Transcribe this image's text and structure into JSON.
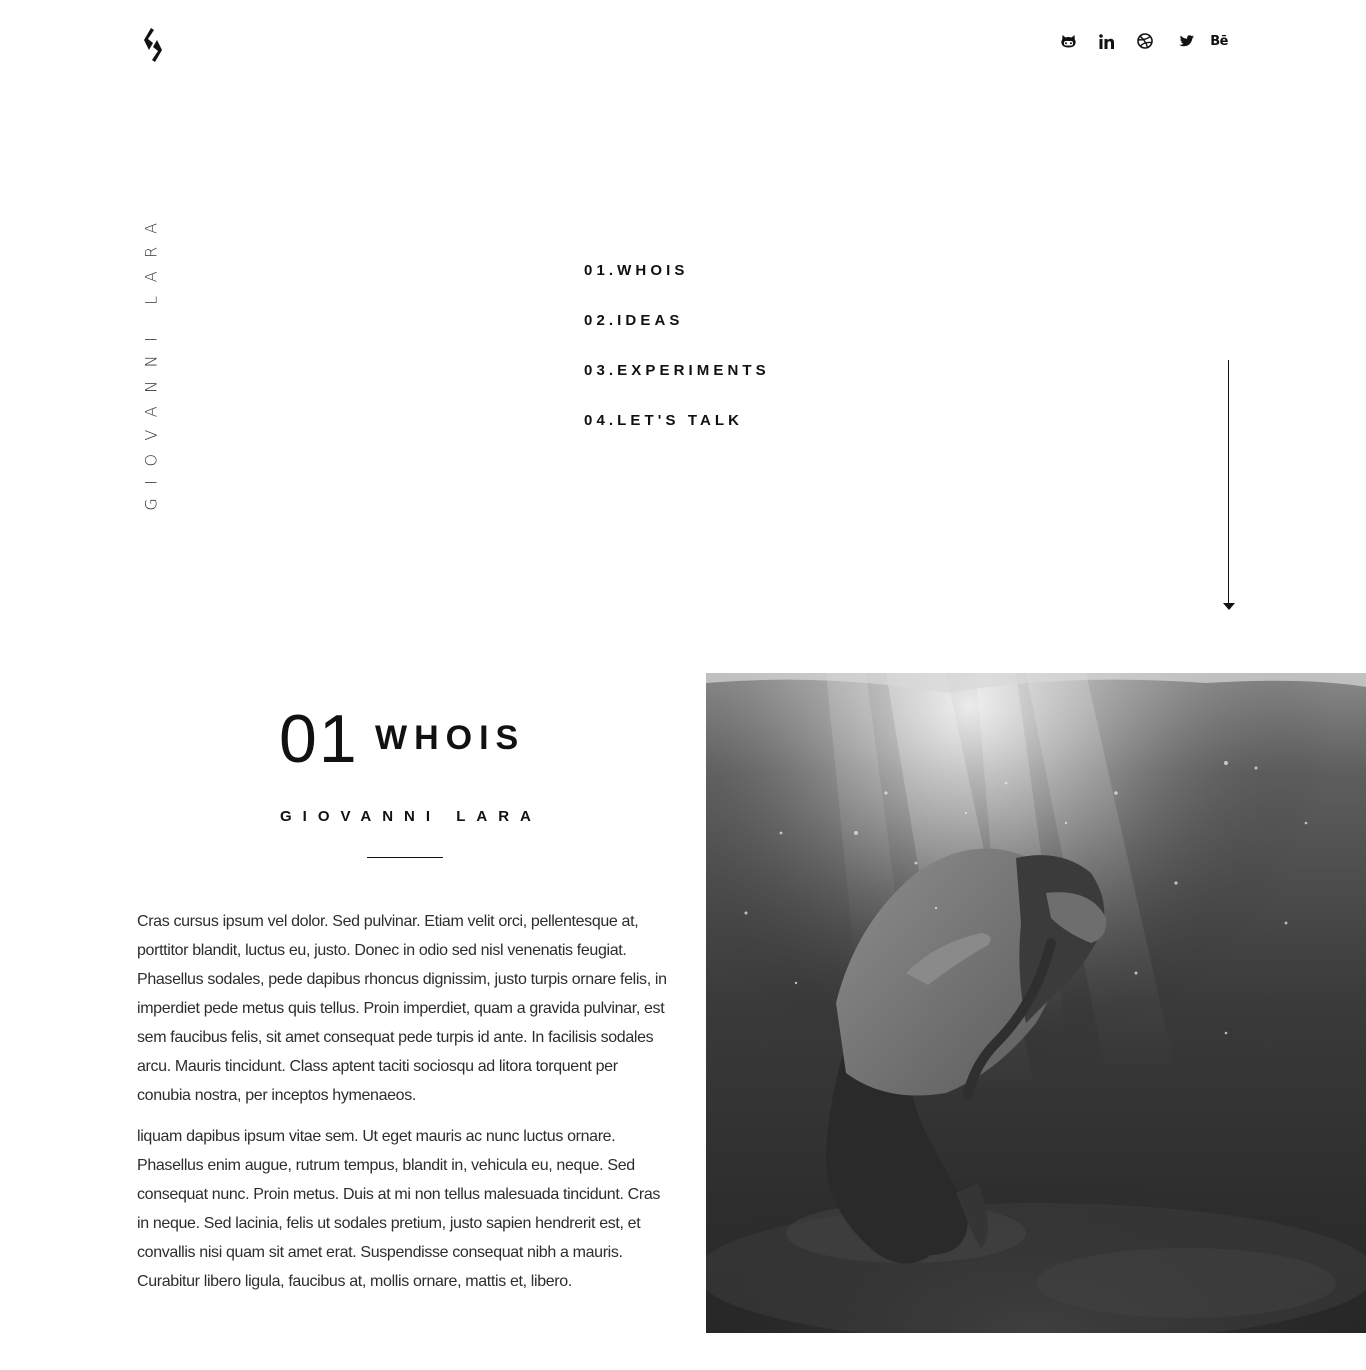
{
  "header": {
    "logo_name": "brand-logo",
    "social_links": [
      {
        "name": "github",
        "icon": "github-icon"
      },
      {
        "name": "linkedin",
        "icon": "linkedin-icon",
        "label": "in"
      },
      {
        "name": "dribbble",
        "icon": "dribbble-icon"
      },
      {
        "name": "twitter",
        "icon": "twitter-icon"
      },
      {
        "name": "behance",
        "icon": "behance-icon",
        "label": "Bē"
      }
    ]
  },
  "sidebar": {
    "vertical_name": "GIOVANNI LARA"
  },
  "nav": {
    "items": [
      {
        "label": "01.WHOIS"
      },
      {
        "label": "02.IDEAS"
      },
      {
        "label": "03.EXPERIMENTS"
      },
      {
        "label": "04.LET'S TALK"
      }
    ]
  },
  "scroll_indicator": {
    "icon": "arrow-down-icon"
  },
  "about": {
    "number": "01",
    "title": "WHOIS",
    "name": "GIOVANNI LARA",
    "paragraphs": [
      "Cras cursus ipsum vel dolor. Sed pulvinar. Etiam velit orci, pellentesque at, porttitor blandit, luctus eu, justo. Donec in odio sed nisl venenatis feugiat. Phasellus sodales, pede dapibus rhoncus dignissim, justo turpis ornare felis, in imperdiet pede metus quis tellus. Proin imperdiet, quam a gravida pulvinar, est sem faucibus felis, sit amet consequat pede turpis id ante. In facilisis sodales arcu. Mauris tincidunt. Class aptent taciti sociosqu ad litora torquent per conubia nostra, per inceptos hymenaeos.",
      "liquam dapibus ipsum vitae sem. Ut eget mauris ac nunc luctus ornare. Phasellus enim augue, rutrum tempus, blandit in, vehicula eu, neque. Sed consequat nunc. Proin metus. Duis at mi non tellus malesuada tincidunt. Cras in neque. Sed lacinia, felis ut sodales pretium, justo sapien hendrerit est, et convallis nisi quam sit amet erat. Suspendisse consequat nibh a mauris. Curabitur libero ligula, faucibus at, mollis ornare, mattis et, libero."
    ],
    "photo": "underwater-figure-photo"
  },
  "colors": {
    "background": "#ffffff",
    "text": "#111111",
    "body_text": "#2d2d2d"
  }
}
